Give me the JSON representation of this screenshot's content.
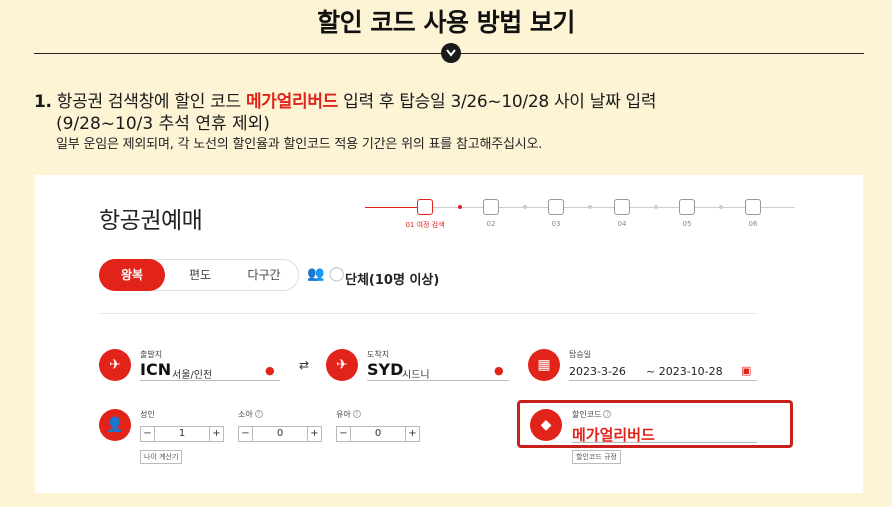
{
  "header": {
    "title": "할인 코드 사용 방법 보기"
  },
  "instruction": {
    "number": "1.",
    "text_before": " 항공권 검색창에 할인 코드 ",
    "promo_code": "메가얼리버드",
    "text_after": " 입력 후 탑승일 3/26~10/28 사이 날짜 입력",
    "line2": "(9/28~10/3 추석 연휴 제외)",
    "note": "일부 운임은 제외되며, 각 노선의 할인율과 할인코드 적용 기간은 위의 표를 참고해주십시오."
  },
  "booking": {
    "title": "항공권예매",
    "progress_steps": [
      {
        "label": "01 여정 검색",
        "icon": "calendar-icon",
        "active": true
      },
      {
        "label": "02",
        "icon": "edit-icon",
        "active": false
      },
      {
        "label": "03",
        "icon": "gift-icon",
        "active": false
      },
      {
        "label": "04",
        "icon": "document-icon",
        "active": false
      },
      {
        "label": "05",
        "icon": "face-icon",
        "active": false
      },
      {
        "label": "06",
        "icon": "card-icon",
        "active": false
      }
    ],
    "trip_tabs": [
      "왕복",
      "편도",
      "다구간"
    ],
    "group_label": "단체(10명 이상)",
    "origin": {
      "label": "출발지",
      "code": "ICN",
      "city": "서울/인천"
    },
    "destination": {
      "label": "도착지",
      "code": "SYD",
      "city": "시드니"
    },
    "dates": {
      "label": "탑승일",
      "start": "2023-3-26",
      "end": "~ 2023-10-28"
    },
    "passengers": {
      "adult": {
        "label": "성인",
        "value": "1"
      },
      "child": {
        "label": "소아",
        "value": "0"
      },
      "infant": {
        "label": "유아",
        "value": "0"
      },
      "age_calc": "나이 계산기"
    },
    "promo": {
      "label": "할인코드",
      "value": "메가얼리버드",
      "rules_button": "할인코드 규정"
    },
    "counter_minus": "−",
    "counter_plus": "+"
  },
  "colors": {
    "accent": "#e2231a",
    "background": "#fdf4d6"
  }
}
